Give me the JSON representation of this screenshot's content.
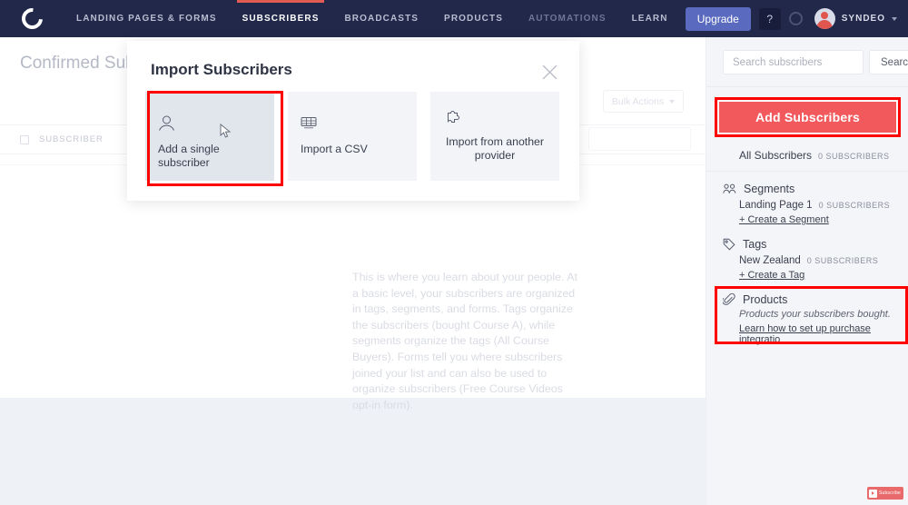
{
  "navbar": {
    "logo_name": "convertkit-logo",
    "items": [
      {
        "label": "LANDING PAGES & FORMS",
        "state": "normal"
      },
      {
        "label": "SUBSCRIBERS",
        "state": "active"
      },
      {
        "label": "BROADCASTS",
        "state": "normal"
      },
      {
        "label": "PRODUCTS",
        "state": "normal"
      },
      {
        "label": "AUTOMATIONS",
        "state": "dim"
      },
      {
        "label": "LEARN",
        "state": "normal"
      }
    ],
    "upgrade_label": "Upgrade",
    "help_label": "?",
    "user_name": "SYNDEO",
    "accent_active": "#e05c52",
    "background": "#21284a",
    "upgrade_color": "#5a6bbf"
  },
  "main": {
    "page_title": "Confirmed Subs",
    "bulk_actions_label": "Bulk Actions",
    "table_header_subscriber": "SUBSCRIBER",
    "empty_text": "This is where you learn about your people. At a basic level, your subscribers are organized in tags, segments, and forms. Tags organize the subscribers (bought Course A), while segments organize the tags (All Course Buyers). Forms tell you where subscribers joined your list and can also be used to organize subscribers (Free Course Videos opt-in form)."
  },
  "modal": {
    "title": "Import Subscribers",
    "close_icon": "close-icon",
    "cards": [
      {
        "label": "Add a single subscriber",
        "icon": "person-icon",
        "selected": true
      },
      {
        "label": "Import a CSV",
        "icon": "csv-file-icon",
        "selected": false
      },
      {
        "label": "Import from another provider",
        "icon": "puzzle-piece-icon",
        "selected": false
      }
    ]
  },
  "sidebar": {
    "search_placeholder": "Search subscribers",
    "search_value": "",
    "search_button_label": "Search",
    "add_subscribers_label": "Add Subscribers",
    "add_subscribers_color": "#f2595c",
    "highlight_color": "#ff0000",
    "all_subscribers": {
      "label": "All Subscribers",
      "count": "0 SUBSCRIBERS"
    },
    "segments": {
      "title": "Segments",
      "icon": "people-group-icon",
      "items": [
        {
          "label": "Landing Page 1",
          "count": "0 SUBSCRIBERS"
        }
      ],
      "create_link": "+ Create a Segment"
    },
    "tags": {
      "title": "Tags",
      "icon": "tag-icon",
      "items": [
        {
          "label": "New Zealand",
          "count": "0 SUBSCRIBERS"
        }
      ],
      "create_link": "+ Create a Tag"
    },
    "products": {
      "title": "Products",
      "icon": "paperclip-icon",
      "note": "Products your subscribers bought.",
      "link": "Learn how to set up purchase integratio"
    }
  },
  "overlay": {
    "youtube_subscribe_label": "Subscribe",
    "youtube_icon": "youtube-play-icon"
  }
}
